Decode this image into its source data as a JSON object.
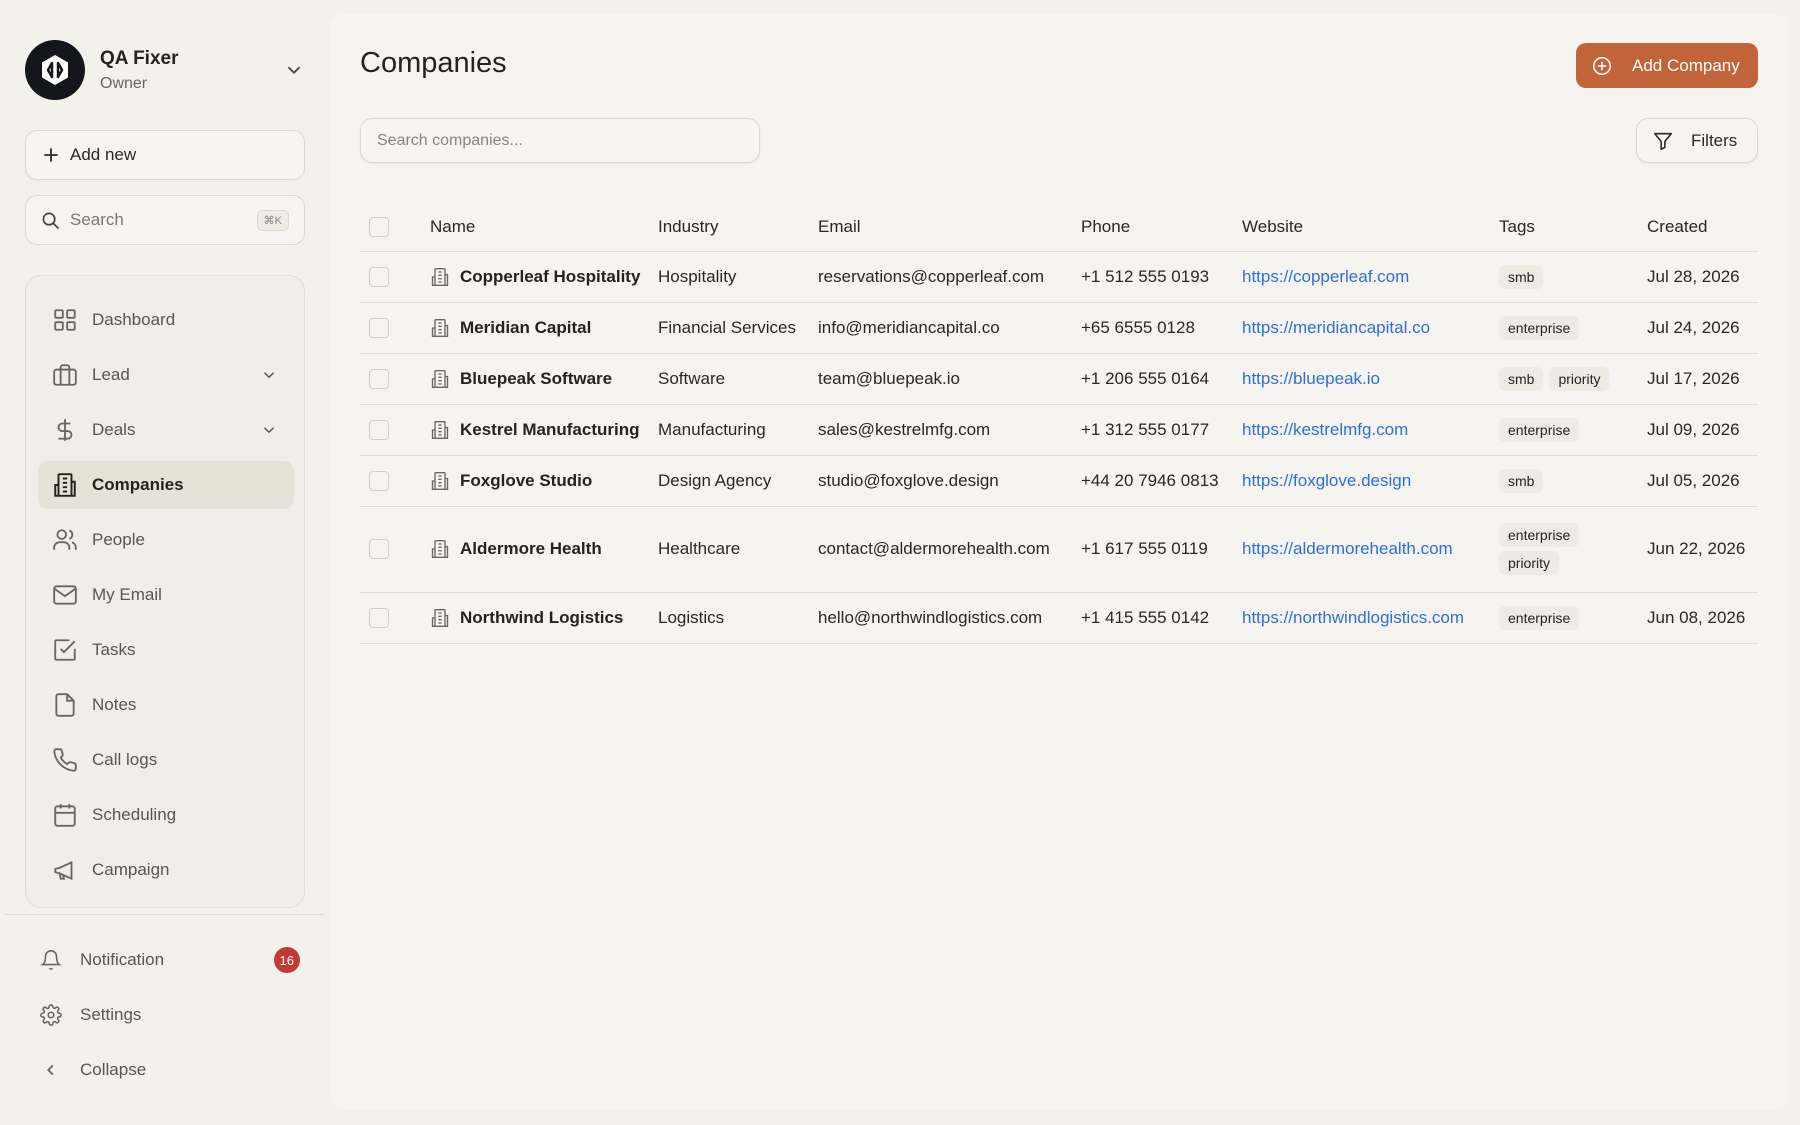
{
  "profile": {
    "name": "QA Fixer",
    "role": "Owner"
  },
  "sidebar": {
    "add_new_label": "Add new",
    "search_placeholder": "Search",
    "search_shortcut": "⌘K",
    "items": [
      {
        "label": "Dashboard",
        "icon": "dashboard-icon"
      },
      {
        "label": "Lead",
        "icon": "briefcase-icon",
        "expandable": true
      },
      {
        "label": "Deals",
        "icon": "dollar-icon",
        "expandable": true
      },
      {
        "label": "Companies",
        "icon": "building-icon",
        "active": true
      },
      {
        "label": "People",
        "icon": "users-icon"
      },
      {
        "label": "My Email",
        "icon": "mail-icon"
      },
      {
        "label": "Tasks",
        "icon": "checkbox-icon"
      },
      {
        "label": "Notes",
        "icon": "note-icon"
      },
      {
        "label": "Call logs",
        "icon": "phone-icon"
      },
      {
        "label": "Scheduling",
        "icon": "calendar-icon"
      },
      {
        "label": "Campaign",
        "icon": "megaphone-icon"
      }
    ],
    "bottom": {
      "notification_label": "Notification",
      "notification_count": "16",
      "settings_label": "Settings",
      "collapse_label": "Collapse"
    }
  },
  "main": {
    "title": "Companies",
    "add_company_label": "Add Company",
    "search_placeholder": "Search companies...",
    "filters_label": "Filters",
    "accent_color": "#c2643a",
    "link_color": "#2f6fd6",
    "columns": [
      "Name",
      "Industry",
      "Email",
      "Phone",
      "Website",
      "Tags",
      "Created"
    ],
    "rows": [
      {
        "name": "Copperleaf Hospitality",
        "industry": "Hospitality",
        "email": "reservations@copperleaf.com",
        "phone": "+1 512 555 0193",
        "website": "https://copperleaf.com",
        "tags": [
          "smb"
        ],
        "created": "Jul 28, 2026"
      },
      {
        "name": "Meridian Capital",
        "industry": "Financial Services",
        "email": "info@meridiancapital.co",
        "phone": "+65 6555 0128",
        "website": "https://meridiancapital.co",
        "tags": [
          "enterprise"
        ],
        "created": "Jul 24, 2026"
      },
      {
        "name": "Bluepeak Software",
        "industry": "Software",
        "email": "team@bluepeak.io",
        "phone": "+1 206 555 0164",
        "website": "https://bluepeak.io",
        "tags": [
          "smb",
          "priority"
        ],
        "created": "Jul 17, 2026"
      },
      {
        "name": "Kestrel Manufacturing",
        "industry": "Manufacturing",
        "email": "sales@kestrelmfg.com",
        "phone": "+1 312 555 0177",
        "website": "https://kestrelmfg.com",
        "tags": [
          "enterprise"
        ],
        "created": "Jul 09, 2026"
      },
      {
        "name": "Foxglove Studio",
        "industry": "Design Agency",
        "email": "studio@foxglove.design",
        "phone": "+44 20 7946 0813",
        "website": "https://foxglove.design",
        "tags": [
          "smb"
        ],
        "created": "Jul 05, 2026"
      },
      {
        "name": "Aldermore Health",
        "industry": "Healthcare",
        "email": "contact@aldermorehealth.com",
        "phone": "+1 617 555 0119",
        "website": "https://aldermorehealth.com",
        "tags": [
          "enterprise",
          "priority"
        ],
        "created": "Jun 22, 2026"
      },
      {
        "name": "Northwind Logistics",
        "industry": "Logistics",
        "email": "hello@northwindlogistics.com",
        "phone": "+1 415 555 0142",
        "website": "https://northwindlogistics.com",
        "tags": [
          "enterprise"
        ],
        "created": "Jun 08, 2026"
      }
    ]
  }
}
